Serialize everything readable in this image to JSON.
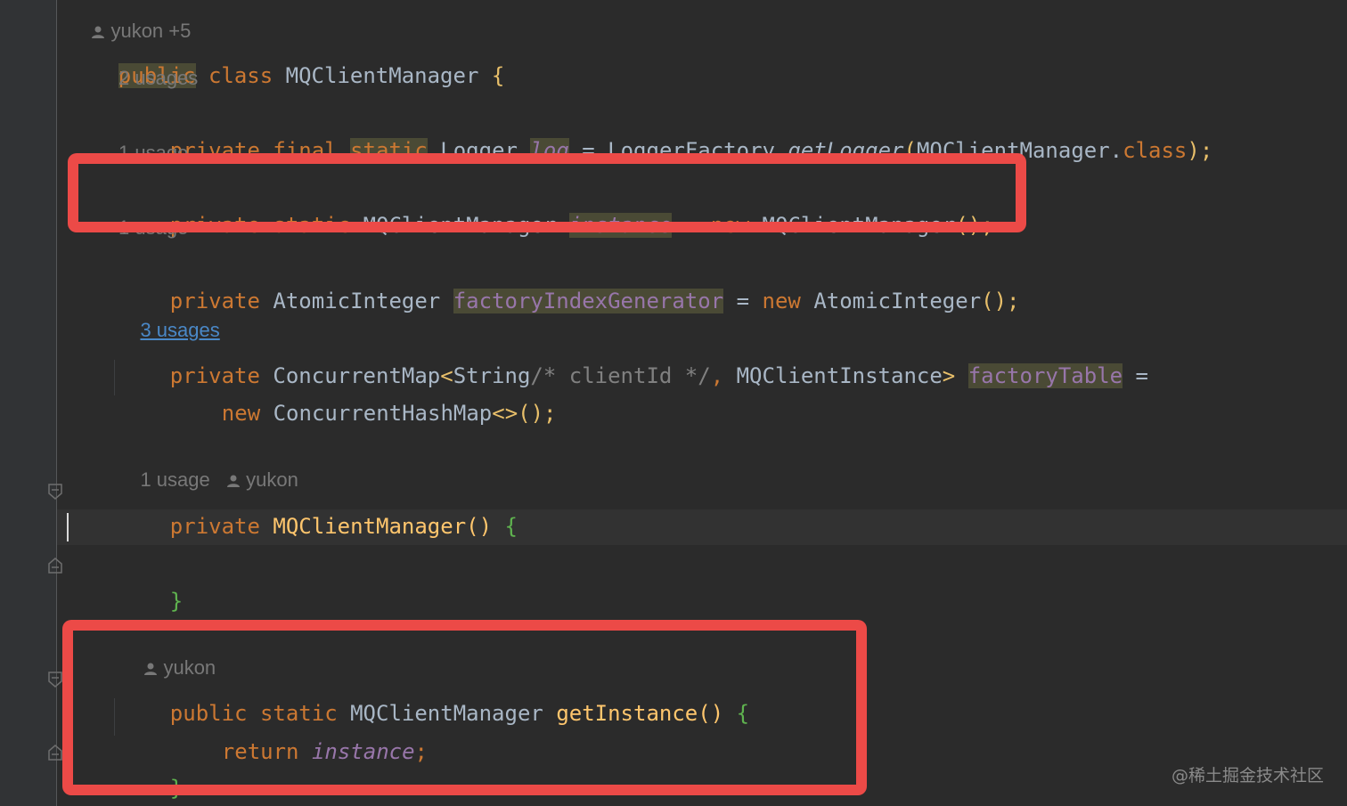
{
  "editor": {
    "top_author_hint": "yukon +5",
    "class_decl": {
      "public": "public",
      "class": "class",
      "name": "MQClientManager",
      "brace": "{"
    },
    "hint_2_usages": "2 usages",
    "logger_line": {
      "private": "private",
      "final": "final",
      "static": "static",
      "type": "Logger",
      "field": "log",
      "eq": "=",
      "factory": "LoggerFactory.",
      "method": "getLogger",
      "open": "(",
      "arg": "MQClientManager.",
      "cls": "class",
      "close": ");"
    },
    "hint_1_usage_a": "1 usage",
    "instance_line": {
      "private": "private",
      "static": "static",
      "type": "MQClientManager",
      "field": "instance",
      "eq": "=",
      "new": "new",
      "ctor": "MQClientManager",
      "parens": "();"
    },
    "hint_1_usage_b": "1 usage",
    "factory_index_line": {
      "private": "private",
      "type": "AtomicInteger",
      "field": "factoryIndexGenerator",
      "eq": "=",
      "new": "new",
      "ctor": "AtomicInteger",
      "parens": "();"
    },
    "hint_3_usages": "3 usages",
    "factory_table_line1": {
      "private": "private",
      "type_a": "ConcurrentMap",
      "lt": "<",
      "string": "String",
      "comment": "/* clientId */",
      "comma": ",",
      "instance_type": "MQClientInstance",
      "gt": ">",
      "field": "factoryTable",
      "eq": "="
    },
    "factory_table_line2": {
      "new": "new",
      "ctor": "ConcurrentHashMap",
      "diamond": "<>",
      "parens": "();"
    },
    "hint_ctor_usage": "1 usage",
    "hint_ctor_author": "yukon",
    "ctor_decl": {
      "private": "private",
      "name": "MQClientManager",
      "parens": "()",
      "brace": "{"
    },
    "ctor_close": "}",
    "hint_getinstance_author": "yukon",
    "getinstance_decl": {
      "public": "public",
      "static": "static",
      "type": "MQClientManager",
      "name": "getInstance",
      "parens": "()",
      "brace": "{"
    },
    "return_line": {
      "return": "return",
      "field": "instance",
      "semi": ";"
    },
    "getinstance_close": "}"
  },
  "watermark": "@稀土掘金技术社区",
  "colors": {
    "background": "#2b2b2b",
    "keyword": "#cc7832",
    "method": "#ffc66d",
    "field": "#9876aa",
    "highlight_box": "#ec4a47"
  },
  "icons": [
    "person-icon",
    "fold-icon"
  ]
}
